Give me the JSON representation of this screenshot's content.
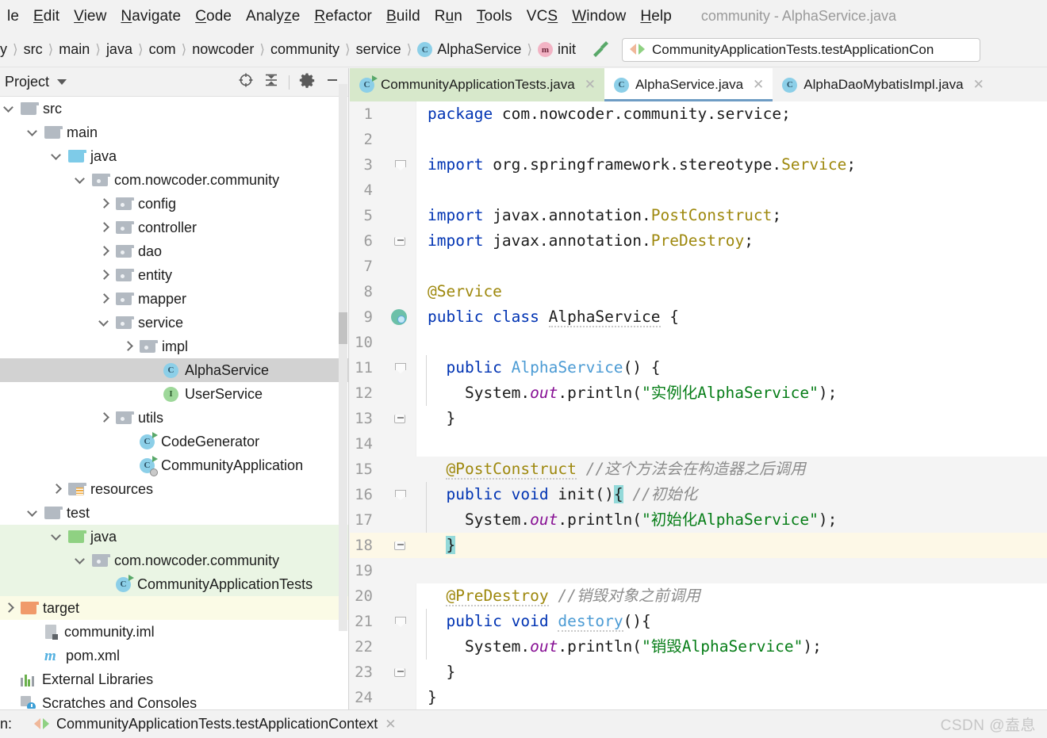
{
  "menu": {
    "items": [
      {
        "label": "le",
        "mnemonic": ""
      },
      {
        "label": "Edit",
        "mnemonic": "E"
      },
      {
        "label": "View",
        "mnemonic": "V"
      },
      {
        "label": "Navigate",
        "mnemonic": "N"
      },
      {
        "label": "Code",
        "mnemonic": "C"
      },
      {
        "label": "Analyze",
        "mnemonic": "z"
      },
      {
        "label": "Refactor",
        "mnemonic": "R"
      },
      {
        "label": "Build",
        "mnemonic": "B"
      },
      {
        "label": "Run",
        "mnemonic": "u"
      },
      {
        "label": "Tools",
        "mnemonic": "T"
      },
      {
        "label": "VCS",
        "mnemonic": "S"
      },
      {
        "label": "Window",
        "mnemonic": "W"
      },
      {
        "label": "Help",
        "mnemonic": "H"
      }
    ],
    "window_title": "community - AlphaService.java"
  },
  "navbar": {
    "crumbs": [
      {
        "label": "y",
        "icon": ""
      },
      {
        "label": "src",
        "icon": ""
      },
      {
        "label": "main",
        "icon": ""
      },
      {
        "label": "java",
        "icon": ""
      },
      {
        "label": "com",
        "icon": ""
      },
      {
        "label": "nowcoder",
        "icon": ""
      },
      {
        "label": "community",
        "icon": ""
      },
      {
        "label": "service",
        "icon": ""
      },
      {
        "label": "AlphaService",
        "icon": "class-icon"
      },
      {
        "label": "init",
        "icon": "method-icon"
      }
    ],
    "build_icon": "hammer-icon",
    "run_config": "CommunityApplicationTests.testApplicationCon"
  },
  "project_panel": {
    "title": "Project",
    "tools": [
      "locate-icon",
      "collapse-all-icon",
      "settings-gear-icon",
      "minimize-icon"
    ],
    "tree": [
      {
        "label": "src",
        "indent": 0,
        "arrow": "down",
        "icon": "folder-grey",
        "state": "normal"
      },
      {
        "label": "main",
        "indent": 1,
        "arrow": "down",
        "icon": "folder-grey",
        "state": "normal"
      },
      {
        "label": "java",
        "indent": 2,
        "arrow": "down",
        "icon": "folder-blue",
        "state": "normal"
      },
      {
        "label": "com.nowcoder.community",
        "indent": 3,
        "arrow": "down",
        "icon": "folder-pkg",
        "state": "normal"
      },
      {
        "label": "config",
        "indent": 4,
        "arrow": "right",
        "icon": "folder-pkg",
        "state": "normal"
      },
      {
        "label": "controller",
        "indent": 4,
        "arrow": "right",
        "icon": "folder-pkg",
        "state": "normal"
      },
      {
        "label": "dao",
        "indent": 4,
        "arrow": "right",
        "icon": "folder-pkg",
        "state": "normal"
      },
      {
        "label": "entity",
        "indent": 4,
        "arrow": "right",
        "icon": "folder-pkg",
        "state": "normal"
      },
      {
        "label": "mapper",
        "indent": 4,
        "arrow": "right",
        "icon": "folder-pkg",
        "state": "normal"
      },
      {
        "label": "service",
        "indent": 4,
        "arrow": "down",
        "icon": "folder-pkg",
        "state": "normal"
      },
      {
        "label": "impl",
        "indent": 5,
        "arrow": "right",
        "icon": "folder-pkg",
        "state": "normal"
      },
      {
        "label": "AlphaService",
        "indent": 6,
        "arrow": "none",
        "icon": "class-icon",
        "state": "selected"
      },
      {
        "label": "UserService",
        "indent": 6,
        "arrow": "none",
        "icon": "interface-icon",
        "state": "normal"
      },
      {
        "label": "utils",
        "indent": 4,
        "arrow": "right",
        "icon": "folder-pkg",
        "state": "normal"
      },
      {
        "label": "CodeGenerator",
        "indent": 5,
        "arrow": "none",
        "icon": "class-run-icon",
        "state": "normal"
      },
      {
        "label": "CommunityApplication",
        "indent": 5,
        "arrow": "none",
        "icon": "class-spring-icon",
        "state": "normal"
      },
      {
        "label": "resources",
        "indent": 2,
        "arrow": "right",
        "icon": "folder-res",
        "state": "normal"
      },
      {
        "label": "test",
        "indent": 1,
        "arrow": "down",
        "icon": "folder-grey",
        "state": "normal"
      },
      {
        "label": "java",
        "indent": 2,
        "arrow": "down",
        "icon": "folder-green",
        "state": "green"
      },
      {
        "label": "com.nowcoder.community",
        "indent": 3,
        "arrow": "down",
        "icon": "folder-pkg",
        "state": "green"
      },
      {
        "label": "CommunityApplicationTests",
        "indent": 4,
        "arrow": "none",
        "icon": "class-run-icon",
        "state": "green"
      },
      {
        "label": "target",
        "indent": 0,
        "arrow": "right",
        "icon": "folder-orange",
        "state": "yellow"
      },
      {
        "label": "community.iml",
        "indent": 1,
        "arrow": "none",
        "icon": "iml-icon",
        "state": "normal"
      },
      {
        "label": "pom.xml",
        "indent": 1,
        "arrow": "none",
        "icon": "maven-icon",
        "state": "normal"
      },
      {
        "label": "External Libraries",
        "indent": 0,
        "arrow": "none",
        "icon": "libraries-icon",
        "state": "normal"
      },
      {
        "label": "Scratches and Consoles",
        "indent": 0,
        "arrow": "none",
        "icon": "scratches-icon",
        "state": "normal"
      }
    ]
  },
  "editor": {
    "tabs": [
      {
        "label": "CommunityApplicationTests.java",
        "icon": "class-run-icon",
        "style": "test",
        "closable": true
      },
      {
        "label": "AlphaService.java",
        "icon": "class-icon",
        "style": "active",
        "closable": true
      },
      {
        "label": "AlphaDaoMybatisImpl.java",
        "icon": "class-icon",
        "style": "normal",
        "closable": true
      }
    ],
    "line_numbers": [
      1,
      2,
      3,
      4,
      5,
      6,
      7,
      8,
      9,
      10,
      11,
      12,
      13,
      14,
      15,
      16,
      17,
      18,
      19,
      20,
      21,
      22,
      23,
      24
    ],
    "current_line": 18,
    "code": [
      {
        "n": 1,
        "text": "package com.nowcoder.community.service;"
      },
      {
        "n": 2,
        "text": ""
      },
      {
        "n": 3,
        "text": "import org.springframework.stereotype.Service;"
      },
      {
        "n": 4,
        "text": ""
      },
      {
        "n": 5,
        "text": "import javax.annotation.PostConstruct;"
      },
      {
        "n": 6,
        "text": "import javax.annotation.PreDestroy;"
      },
      {
        "n": 7,
        "text": ""
      },
      {
        "n": 8,
        "text": "@Service"
      },
      {
        "n": 9,
        "text": "public class AlphaService {"
      },
      {
        "n": 10,
        "text": ""
      },
      {
        "n": 11,
        "text": "  public AlphaService() {"
      },
      {
        "n": 12,
        "text": "    System.out.println(\"实例化AlphaService\");"
      },
      {
        "n": 13,
        "text": "  }"
      },
      {
        "n": 14,
        "text": ""
      },
      {
        "n": 15,
        "text": "  @PostConstruct //这个方法会在构造器之后调用"
      },
      {
        "n": 16,
        "text": "  public void init(){ //初始化"
      },
      {
        "n": 17,
        "text": "    System.out.println(\"初始化AlphaService\");"
      },
      {
        "n": 18,
        "text": "  }"
      },
      {
        "n": 19,
        "text": ""
      },
      {
        "n": 20,
        "text": "  @PreDestroy //销毁对象之前调用"
      },
      {
        "n": 21,
        "text": "  public void destory(){"
      },
      {
        "n": 22,
        "text": "    System.out.println(\"销毁AlphaService\");"
      },
      {
        "n": 23,
        "text": "  }"
      },
      {
        "n": 24,
        "text": "}"
      }
    ]
  },
  "statusbar": {
    "prefix": "n:",
    "run_tab_label": "CommunityApplicationTests.testApplicationContext",
    "run_tab_icon": "run-config-icon",
    "close_icon": "close-icon"
  },
  "watermark": "CSDN @盍息",
  "colors": {
    "selection": "#d2d2d2",
    "test_source": "#eaf5e4",
    "target_dir": "#fbfbe6",
    "active_tab_underline": "#6e9cc4",
    "keyword": "#0033b3",
    "string": "#067d17",
    "annotation": "#9e880d",
    "comment": "#8c8c8c",
    "static_field": "#871094",
    "class_decl": "#4b9bd4",
    "current_line": "#fdf8e7",
    "brace_match": "#93d9d9"
  }
}
